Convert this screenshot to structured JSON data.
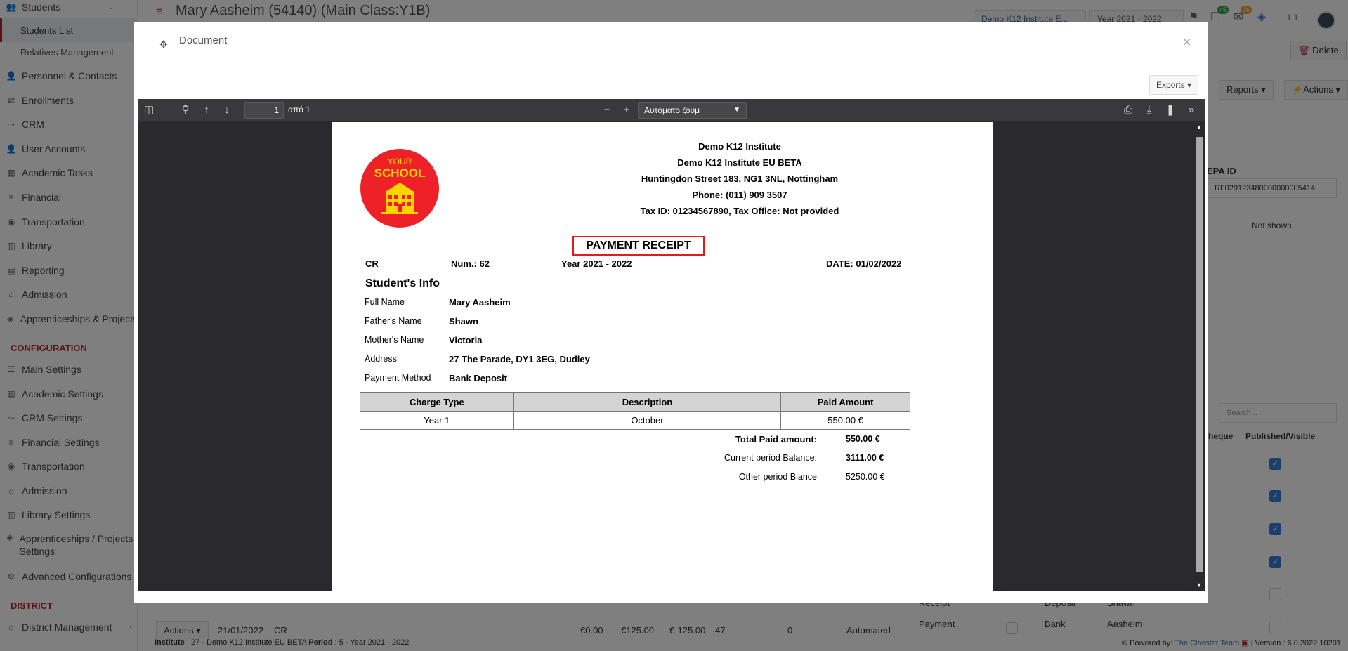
{
  "app": {
    "page_title": "Mary Aasheim (54140) (Main Class:Y1B)",
    "institute_chip": "Demo K12 Institute E...",
    "year_chip": "Year 2021 - 2022",
    "badge_messages": "45",
    "badge_mail": "36",
    "user_label": "1 1"
  },
  "sidebar": {
    "students_label": "Students",
    "students_list": "Students List",
    "relatives": "Relatives Management",
    "items": [
      {
        "label": "Personnel & Contacts",
        "icon": "users-icon"
      },
      {
        "label": "Enrollments",
        "icon": "exchange-icon"
      },
      {
        "label": "CRM",
        "icon": "crm-icon"
      },
      {
        "label": "User Accounts",
        "icon": "user-icon"
      },
      {
        "label": "Academic Tasks",
        "icon": "grid-icon"
      },
      {
        "label": "Financial",
        "icon": "database-icon"
      },
      {
        "label": "Transportation",
        "icon": "bus-icon"
      },
      {
        "label": "Library",
        "icon": "library-icon"
      },
      {
        "label": "Reporting",
        "icon": "print-icon"
      },
      {
        "label": "Admission",
        "icon": "building-icon"
      },
      {
        "label": "Apprenticeships & Projects",
        "icon": "cube-icon"
      }
    ],
    "config_head": "CONFIGURATION",
    "config_items": [
      {
        "label": "Main Settings",
        "icon": "sliders-icon"
      },
      {
        "label": "Academic Settings",
        "icon": "grid-icon"
      },
      {
        "label": "CRM Settings",
        "icon": "crm-icon"
      },
      {
        "label": "Financial Settings",
        "icon": "database-icon"
      },
      {
        "label": "Transportation",
        "icon": "bus-icon"
      },
      {
        "label": "Admission",
        "icon": "building-icon"
      },
      {
        "label": "Library Settings",
        "icon": "library-icon"
      },
      {
        "label": "Apprenticeships / Projects Settings",
        "icon": "cube-icon"
      },
      {
        "label": "Advanced Configurations",
        "icon": "cogs-icon"
      }
    ],
    "district_head": "DISTRICT",
    "district_item": "District Management"
  },
  "background": {
    "delete_label": "Delete",
    "reports_label": "Reports",
    "actions_label": "Actions",
    "epa_label": "EPA ID",
    "epa_value": "RF029123480000000005414",
    "not_shown": "Not shown",
    "search_placeholder": "Search...",
    "col_cheque": "heque",
    "col_published": "Published/Visible",
    "row_actions": "Actions",
    "row_date": "21/01/2022",
    "row_type": "CR",
    "row_v1": "€0.00",
    "row_v2": "€125.00",
    "row_v3": "€-125.00",
    "row_v4": "47",
    "row_v5": "0",
    "row_status": "Automated",
    "row_payment": "Payment",
    "row_bank": "Bank",
    "row_name": "Aasheim",
    "ghost_receipt": "Receipt",
    "ghost_deposit": "Deposit",
    "ghost_shawn": "Shawn"
  },
  "footer": {
    "institute_label": "Institute",
    "institute_value": ": 27 - Demo K12 Institute EU BETA",
    "period_label": "Period",
    "period_value": ": 5 - Year 2021 - 2022",
    "powered_by": "Powered by:",
    "team": "The Classter Team",
    "version": "| Version : 6.0.2022.10201"
  },
  "modal": {
    "title": "Document",
    "exports_label": "Exports",
    "close_symbol": "×"
  },
  "pdf_toolbar": {
    "page_value": "1",
    "page_of": "από 1",
    "zoom_label": "Αυτόματο ζουμ"
  },
  "receipt": {
    "logo_text_top": "YOUR",
    "logo_text_main": "SCHOOL",
    "institute_lines": [
      "Demo K12 Institute",
      "Demo K12 Institute EU BETA",
      "Huntingdon Street 183, NG1 3NL, Nottingham",
      "Phone: (011) 909 3507",
      "Tax ID: 01234567890, Tax Office: Not provided"
    ],
    "title": "PAYMENT RECEIPT",
    "doc_type": "CR",
    "num": "Num.: 62",
    "year": "Year 2021 - 2022",
    "date": "DATE: 01/02/2022",
    "section_title": "Student's Info",
    "info": [
      {
        "label": "Full Name",
        "value": "Mary Aasheim"
      },
      {
        "label": "Father's Name",
        "value": "Shawn"
      },
      {
        "label": "Mother's Name",
        "value": "Victoria"
      },
      {
        "label": "Address",
        "value": "27 The Parade, DY1 3EG, Dudley"
      },
      {
        "label": "Payment Method",
        "value": "Bank Deposit"
      }
    ],
    "table_headers": [
      "Charge Type",
      "Description",
      "Paid  Amount"
    ],
    "table_rows": [
      [
        "Year 1",
        "October",
        "550.00 €"
      ]
    ],
    "total_label": "Total Paid amount:",
    "total_value": "550.00 €",
    "current_label": "Current period Balance:",
    "current_value": "3111.00 €",
    "other_label": "Other period Blance",
    "other_value": "5250.00 €"
  },
  "colors": {
    "brand_red": "#b5262e",
    "logo_red": "#ee2128",
    "logo_yellow": "#ffd400",
    "receipt_border": "#e01c1c"
  }
}
